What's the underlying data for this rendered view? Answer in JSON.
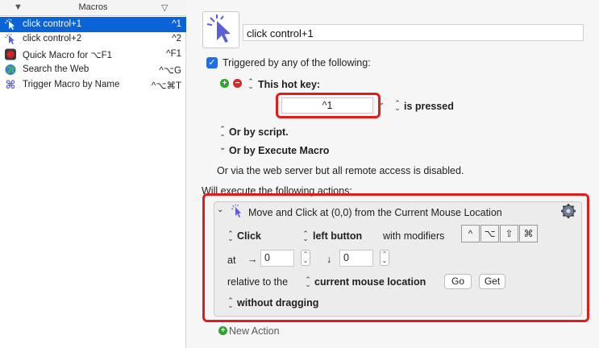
{
  "sidebar": {
    "header_title": "Macros",
    "items": [
      {
        "label": "click control+1",
        "shortcut": "^1",
        "icon": "pointer-click-icon"
      },
      {
        "label": "click control+2",
        "shortcut": "^2",
        "icon": "pointer-click-icon"
      },
      {
        "label": "Quick Macro for ⌥F1",
        "shortcut": "^F1",
        "icon": "record-icon"
      },
      {
        "label": "Search the Web",
        "shortcut": "^⌥G",
        "icon": "globe-icon"
      },
      {
        "label": "Trigger Macro by Name",
        "shortcut": "^⌥⌘T",
        "icon": "command-icon"
      }
    ]
  },
  "macro": {
    "name": "click control+1",
    "trigger_header": "Triggered by any of the following:",
    "hotkey_label": "This hot key:",
    "hotkey_value": "^1",
    "hotkey_state": "is pressed",
    "or_script": "Or by script.",
    "or_execute": "Or by Execute Macro",
    "web_note": "Or via the web server but all remote access is disabled.",
    "actions_header": "Will execute the following actions:",
    "new_action": "New Action"
  },
  "action": {
    "title": "Move and Click at (0,0) from the Current Mouse Location",
    "click_type": "Click",
    "button": "left button",
    "modifiers_label": "with modifiers",
    "modifiers": [
      "^",
      "⌥",
      "⇧",
      "⌘"
    ],
    "at_label": "at",
    "x_arrow": "→",
    "x_value": "0",
    "y_arrow": "↓",
    "y_value": "0",
    "relative_label": "relative to the",
    "relative_to": "current mouse location",
    "go_label": "Go",
    "get_label": "Get",
    "drag_mode": "without dragging"
  },
  "colors": {
    "selection": "#0a64d8",
    "highlight_box": "#e01c1c",
    "checkbox": "#1e6ee6"
  }
}
